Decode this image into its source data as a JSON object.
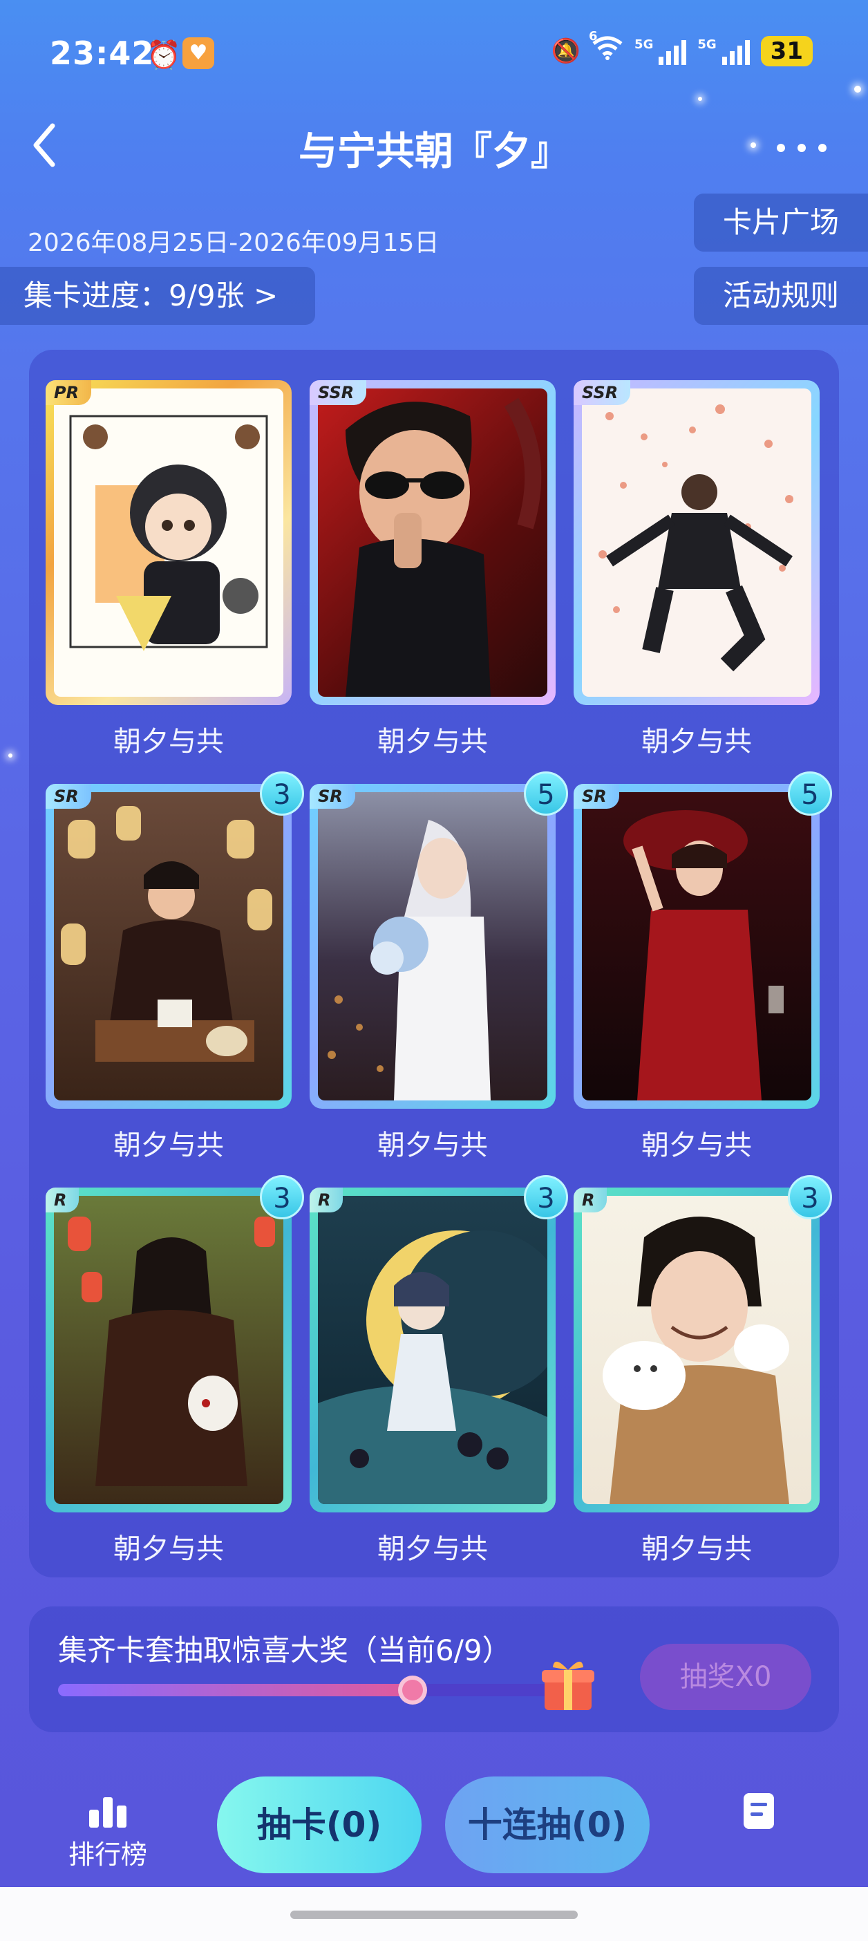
{
  "status_bar": {
    "time": "23:42",
    "network_1": "5G",
    "network_2": "5G",
    "wifi_label": "6",
    "battery": "31",
    "icons": [
      "alarm-icon",
      "heart-app-icon",
      "mute-icon",
      "wifi-icon",
      "signal-icon",
      "signal-icon",
      "battery-icon"
    ]
  },
  "header": {
    "back_icon": "back-arrow-icon",
    "title": "与宁共朝『夕』",
    "more_icon": "more-dots-icon"
  },
  "event": {
    "date_range": "2026年08月25日-2026年09月15日",
    "progress_label": "集卡进度：9/9张 >",
    "square_button": "卡片广场",
    "rules_button": "活动规则"
  },
  "cards": [
    {
      "rarity": "PR",
      "caption": "朝夕与共",
      "count": ""
    },
    {
      "rarity": "SSR",
      "caption": "朝夕与共",
      "count": ""
    },
    {
      "rarity": "SSR",
      "caption": "朝夕与共",
      "count": ""
    },
    {
      "rarity": "SR",
      "caption": "朝夕与共",
      "count": "3"
    },
    {
      "rarity": "SR",
      "caption": "朝夕与共",
      "count": "5"
    },
    {
      "rarity": "SR",
      "caption": "朝夕与共",
      "count": "5"
    },
    {
      "rarity": "R",
      "caption": "朝夕与共",
      "count": "3"
    },
    {
      "rarity": "R",
      "caption": "朝夕与共",
      "count": "3"
    },
    {
      "rarity": "R",
      "caption": "朝夕与共",
      "count": "3"
    }
  ],
  "lottery": {
    "text": "集齐卡套抽取惊喜大奖（当前6/9）",
    "progress_fraction": 0.6667,
    "draw_button": "抽奖X0",
    "gift_icon": "gift-box-icon"
  },
  "bottom_bar": {
    "rank_label": "排行榜",
    "rank_icon": "leaderboard-icon",
    "draw_one": "抽卡(0)",
    "draw_ten": "十连抽(0)",
    "doc_icon": "document-icon"
  },
  "colors": {
    "accent_cyan": "#4dd6f0",
    "panel": "#3c46c8",
    "pr_gold": "#f2b64a"
  }
}
